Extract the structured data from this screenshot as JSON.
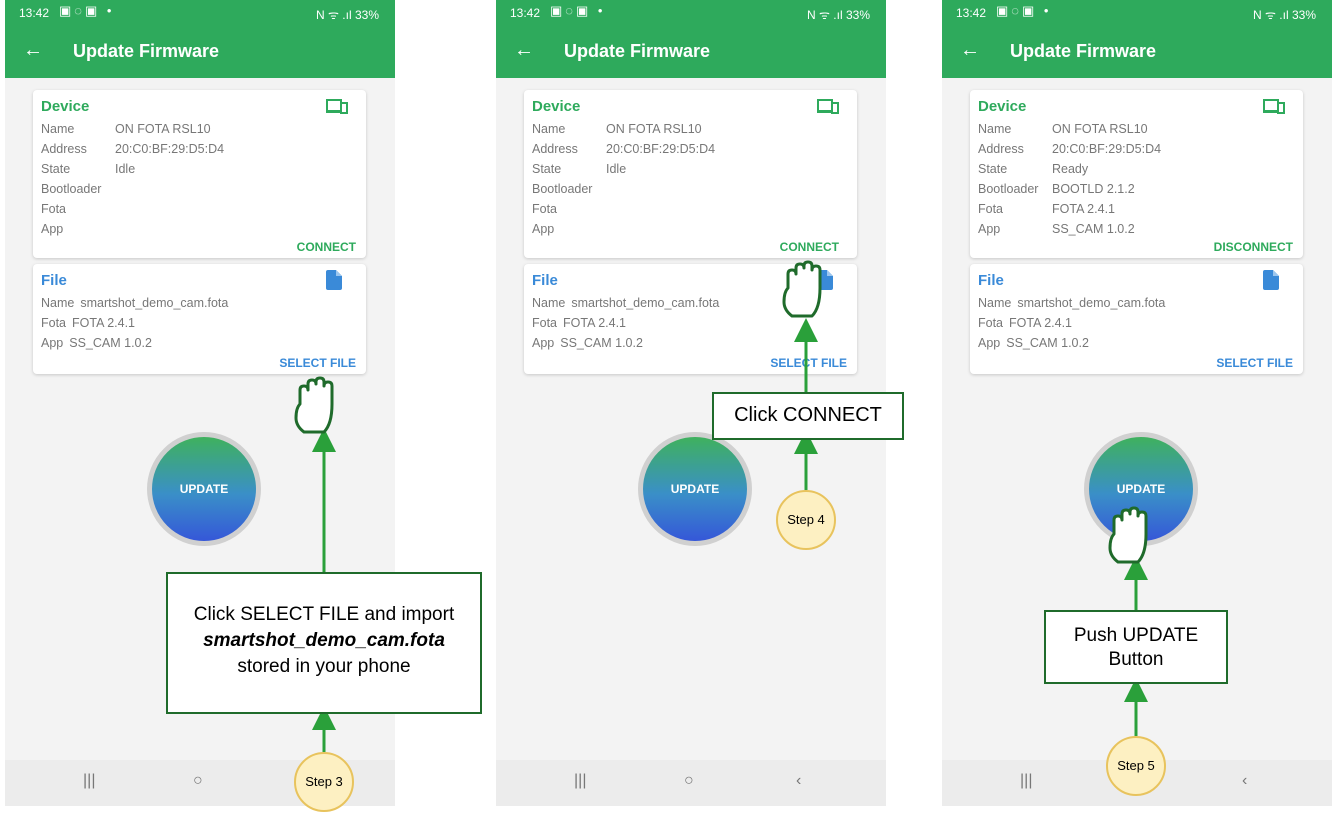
{
  "screens": [
    {
      "status_time": "13:42",
      "status_right": "N ᯤ .ıl 33%",
      "title": "Update Firmware",
      "device": {
        "heading": "Device",
        "rows": [
          {
            "label": "Name",
            "value": "ON FOTA RSL10"
          },
          {
            "label": "Address",
            "value": "20:C0:BF:29:D5:D4"
          },
          {
            "label": "State",
            "value": "Idle"
          },
          {
            "label": "Bootloader",
            "value": ""
          },
          {
            "label": "Fota",
            "value": ""
          },
          {
            "label": "App",
            "value": ""
          }
        ],
        "action": "CONNECT"
      },
      "file": {
        "heading": "File",
        "rows": [
          {
            "label": "Name",
            "value": "smartshot_demo_cam.fota"
          },
          {
            "label": "Fota",
            "value": "FOTA  2.4.1"
          },
          {
            "label": "App",
            "value": "SS_CAM 1.0.2"
          }
        ],
        "action": "SELECT FILE"
      },
      "update_label": "UPDATE",
      "nav": [
        "|||",
        "○",
        "‹"
      ]
    },
    {
      "status_time": "13:42",
      "status_right": "N ᯤ .ıl 33%",
      "title": "Update Firmware",
      "device": {
        "heading": "Device",
        "rows": [
          {
            "label": "Name",
            "value": "ON FOTA RSL10"
          },
          {
            "label": "Address",
            "value": "20:C0:BF:29:D5:D4"
          },
          {
            "label": "State",
            "value": "Idle"
          },
          {
            "label": "Bootloader",
            "value": ""
          },
          {
            "label": "Fota",
            "value": ""
          },
          {
            "label": "App",
            "value": ""
          }
        ],
        "action": "CONNECT"
      },
      "file": {
        "heading": "File",
        "rows": [
          {
            "label": "Name",
            "value": "smartshot_demo_cam.fota"
          },
          {
            "label": "Fota",
            "value": "FOTA  2.4.1"
          },
          {
            "label": "App",
            "value": "SS_CAM 1.0.2"
          }
        ],
        "action": "SELECT FILE"
      },
      "update_label": "UPDATE",
      "nav": [
        "|||",
        "○",
        "‹"
      ]
    },
    {
      "status_time": "13:42",
      "status_right": "N ᯤ .ıl 33%",
      "title": "Update Firmware",
      "device": {
        "heading": "Device",
        "rows": [
          {
            "label": "Name",
            "value": "ON FOTA RSL10"
          },
          {
            "label": "Address",
            "value": "20:C0:BF:29:D5:D4"
          },
          {
            "label": "State",
            "value": "Ready"
          },
          {
            "label": "Bootloader",
            "value": "BOOTLD 2.1.2"
          },
          {
            "label": "Fota",
            "value": "FOTA  2.4.1"
          },
          {
            "label": "App",
            "value": "SS_CAM 1.0.2"
          }
        ],
        "action": "DISCONNECT"
      },
      "file": {
        "heading": "File",
        "rows": [
          {
            "label": "Name",
            "value": "smartshot_demo_cam.fota"
          },
          {
            "label": "Fota",
            "value": "FOTA  2.4.1"
          },
          {
            "label": "App",
            "value": "SS_CAM 1.0.2"
          }
        ],
        "action": "SELECT FILE"
      },
      "update_label": "UPDATE",
      "nav": [
        "|||",
        "○",
        "‹"
      ]
    }
  ],
  "annotations": {
    "step3": {
      "label": "Step 3",
      "line1": "Click SELECT FILE and import",
      "line2": "smartshot_demo_cam.fota",
      "line3": "stored in your phone"
    },
    "step4": {
      "label": "Step 4",
      "text": "Click CONNECT"
    },
    "step5": {
      "label": "Step 5",
      "line1": "Push UPDATE",
      "line2": "Button"
    }
  },
  "colors": {
    "primary": "#2eaa5c",
    "file_accent": "#3a8ad8",
    "annotation": "#1f6b2b",
    "step_fill": "#fdf0c2"
  },
  "icons": {
    "back": "arrow-left-icon",
    "device": "devices-icon",
    "file": "file-icon",
    "hand": "pointing-hand-icon"
  }
}
